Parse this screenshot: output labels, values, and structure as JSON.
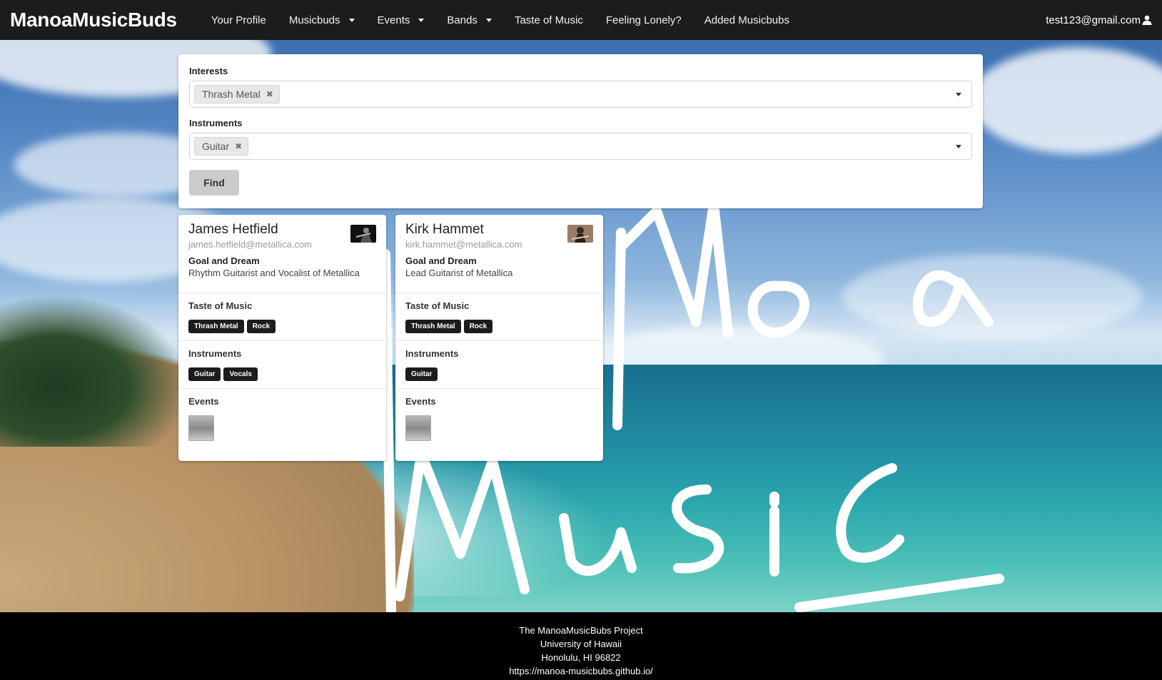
{
  "nav": {
    "brand": "ManoaMusicBuds",
    "items": [
      {
        "label": "Your Profile",
        "dropdown": false
      },
      {
        "label": "Musicbuds",
        "dropdown": true
      },
      {
        "label": "Events",
        "dropdown": true
      },
      {
        "label": "Bands",
        "dropdown": true
      },
      {
        "label": "Taste of Music",
        "dropdown": false
      },
      {
        "label": "Feeling Lonely?",
        "dropdown": false
      },
      {
        "label": "Added Musicbubs",
        "dropdown": false
      }
    ],
    "user_email": "test123@gmail.com"
  },
  "search": {
    "interests_label": "Interests",
    "interests_selected": [
      "Thrash Metal"
    ],
    "instruments_label": "Instruments",
    "instruments_selected": [
      "Guitar"
    ],
    "find_button": "Find"
  },
  "cards": [
    {
      "name": "James Hetfield",
      "email": "james.hetfield@metallica.com",
      "goal_title": "Goal and Dream",
      "goal": "Rhythm Guitarist and Vocalist of Metallica",
      "taste_title": "Taste of Music",
      "tastes": [
        "Thrash Metal",
        "Rock"
      ],
      "instruments_title": "Instruments",
      "instruments": [
        "Guitar",
        "Vocals"
      ],
      "events_title": "Events"
    },
    {
      "name": "Kirk Hammet",
      "email": "kirk.hammet@metallica.com",
      "goal_title": "Goal and Dream",
      "goal": "Lead Guitarist of Metallica",
      "taste_title": "Taste of Music",
      "tastes": [
        "Thrash Metal",
        "Rock"
      ],
      "instruments_title": "Instruments",
      "instruments": [
        "Guitar"
      ],
      "events_title": "Events"
    }
  ],
  "footer": {
    "line1": "The ManoaMusicBubs Project",
    "line2": "University of Hawaii",
    "line3": "Honolulu, HI 96822",
    "line4": "https://manoa-musicbubs.github.io/"
  },
  "colors": {
    "navbar": "#1b1c1d",
    "tag": "#1b1c1d",
    "footer": "#000000",
    "find_button": "#cacbcd"
  }
}
